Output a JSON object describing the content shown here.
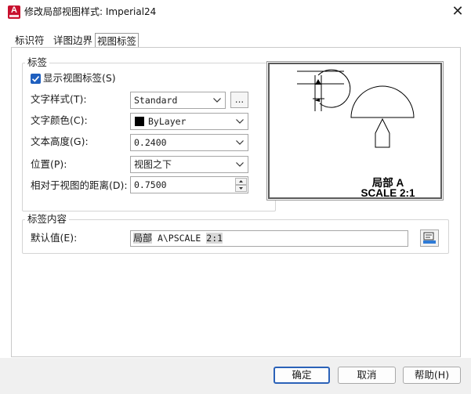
{
  "window": {
    "title": "修改局部视图样式: Imperial24",
    "app_icon_letter": "A",
    "close_glyph": "✕"
  },
  "tabs": [
    {
      "label": "标识符",
      "active": false
    },
    {
      "label": "详图边界",
      "active": false
    },
    {
      "label": "视图标签",
      "active": true
    }
  ],
  "label_group": {
    "title": "标签",
    "show_label": {
      "label": "显示视图标签(S)",
      "checked": true
    },
    "text_style": {
      "label": "文字样式(T):",
      "value": "Standard",
      "browse_label": "..."
    },
    "text_color": {
      "label": "文字颜色(C):",
      "value": "ByLayer",
      "swatch_color": "#000000"
    },
    "text_height": {
      "label": "文本高度(G):",
      "value": "0.2400"
    },
    "position": {
      "label": "位置(P):",
      "value": "视图之下"
    },
    "offset": {
      "label": "相对于视图的距离(D):",
      "value": "0.7500"
    }
  },
  "preview": {
    "line1": "局部 A",
    "line2": "SCALE 2:1"
  },
  "content_group": {
    "title": "标签内容",
    "default_label": "默认值(E):",
    "value_part1": "局部",
    "value_part2": " A\\PSCALE ",
    "value_part3": "2:1"
  },
  "footer": {
    "ok": "确定",
    "cancel": "取消",
    "help": "帮助(H)"
  },
  "colors": {
    "accent": "#1e5fbf",
    "app_icon": "#c8102e",
    "default_button_border": "#2b62b8"
  }
}
